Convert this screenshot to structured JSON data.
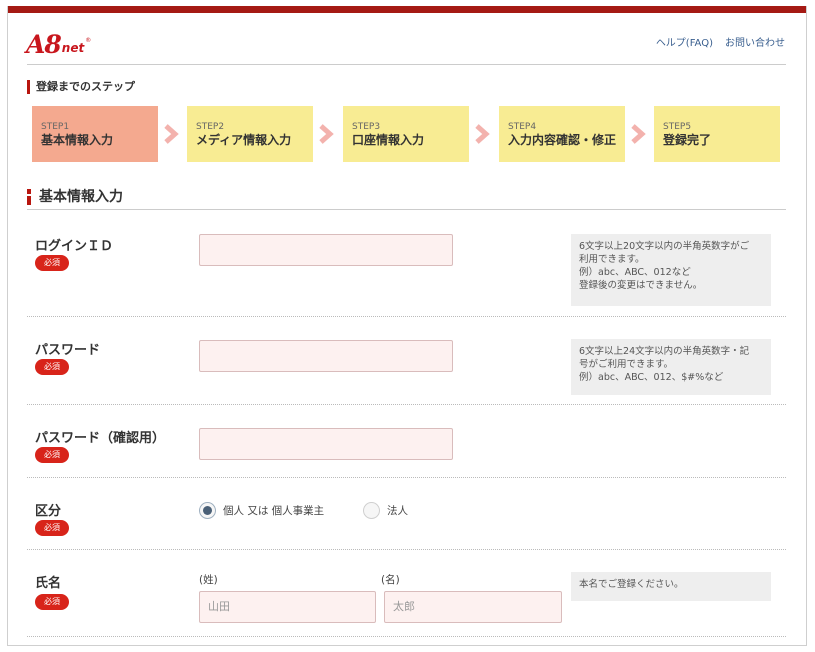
{
  "header": {
    "logo": {
      "main": "A8",
      "suffix": "net"
    },
    "links": [
      "ヘルプ(FAQ)",
      "お問い合わせ"
    ]
  },
  "steps_title": "登録までのステップ",
  "steps": [
    {
      "num": "STEP1",
      "name": "基本情報入力",
      "active": true
    },
    {
      "num": "STEP2",
      "name": "メディア情報入力",
      "active": false
    },
    {
      "num": "STEP3",
      "name": "口座情報入力",
      "active": false
    },
    {
      "num": "STEP4",
      "name": "入力内容確認・修正",
      "active": false
    },
    {
      "num": "STEP5",
      "name": "登録完了",
      "active": false
    }
  ],
  "section_title": "基本情報入力",
  "required_badge": "必須",
  "fields": {
    "login_id": {
      "label": "ログインＩＤ",
      "value": "",
      "hint": [
        "6文字以上20文字以内の半角英数字がご",
        "利用できます。",
        "例）abc、ABC、012など",
        "登録後の変更はできません。"
      ]
    },
    "password": {
      "label": "パスワード",
      "value": "",
      "hint": [
        "6文字以上24文字以内の半角英数字・記",
        "号がご利用できます。",
        "例）abc、ABC、012、$#%など"
      ]
    },
    "password_confirm": {
      "label": "パスワード（確認用）",
      "value": ""
    },
    "category": {
      "label": "区分",
      "options": [
        "個人 又は 個人事業主",
        "法人"
      ],
      "selected": "個人 又は 個人事業主"
    },
    "name": {
      "label": "氏名",
      "last_label": "(姓)",
      "first_label": "(名)",
      "last_placeholder": "山田",
      "first_placeholder": "太郎",
      "hint": [
        "本名でご登録ください。"
      ]
    }
  },
  "colors": {
    "topbar": "#a51a14",
    "step_active": "#f4a98f",
    "step_inactive": "#f8ec93",
    "required": "#d8241a",
    "input_bg": "#fdf1f0"
  }
}
